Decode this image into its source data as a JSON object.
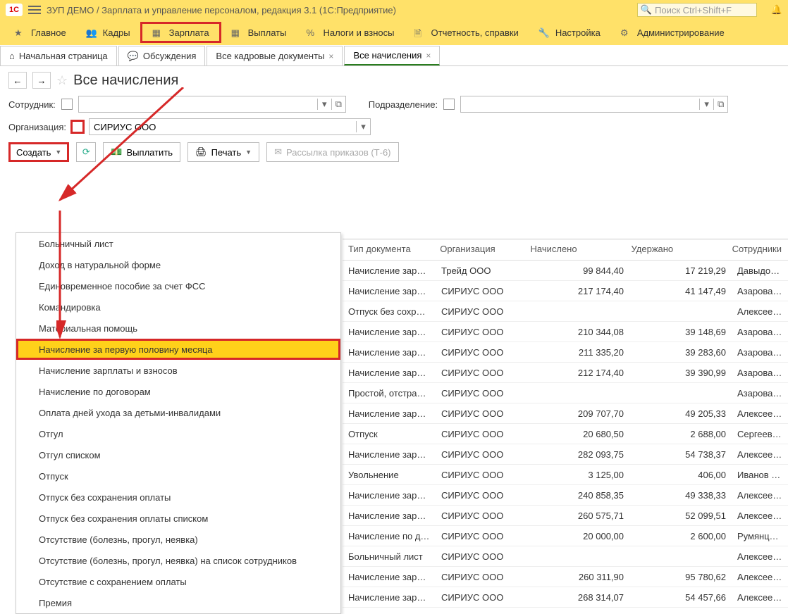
{
  "titlebar": {
    "title": "ЗУП ДЕМО / Зарплата и управление персоналом, редакция 3.1  (1С:Предприятие)",
    "search_placeholder": "Поиск Ctrl+Shift+F"
  },
  "mainmenu": [
    {
      "label": "Главное",
      "icon": "star"
    },
    {
      "label": "Кадры",
      "icon": "people"
    },
    {
      "label": "Зарплата",
      "icon": "grid",
      "highlight": true
    },
    {
      "label": "Выплаты",
      "icon": "grid"
    },
    {
      "label": "Налоги и взносы",
      "icon": "percent"
    },
    {
      "label": "Отчетность, справки",
      "icon": "doc"
    },
    {
      "label": "Настройка",
      "icon": "wrench"
    },
    {
      "label": "Администрирование",
      "icon": "gear"
    }
  ],
  "tabs": [
    {
      "label": "Начальная страница",
      "closable": false,
      "icon": "home"
    },
    {
      "label": "Обсуждения",
      "closable": false,
      "icon": "chat"
    },
    {
      "label": "Все кадровые документы",
      "closable": true
    },
    {
      "label": "Все начисления",
      "closable": true,
      "active": true
    }
  ],
  "page_title": "Все начисления",
  "filters": {
    "employee_label": "Сотрудник:",
    "department_label": "Подразделение:",
    "org_label": "Организация:",
    "org_value": "СИРИУС ООО"
  },
  "toolbar": {
    "create": "Создать",
    "pay": "Выплатить",
    "print": "Печать",
    "mail": "Рассылка приказов (Т-6)"
  },
  "dropdown": [
    "Больничный лист",
    "Доход в натуральной форме",
    "Единовременное пособие за счет ФСС",
    "Командировка",
    "Материальная помощь",
    "Начисление за первую половину месяца",
    "Начисление зарплаты и взносов",
    "Начисление по договорам",
    "Оплата дней ухода за детьми-инвалидами",
    "Отгул",
    "Отгул списком",
    "Отпуск",
    "Отпуск без сохранения оплаты",
    "Отпуск без сохранения оплаты списком",
    "Отсутствие (болезнь, прогул, неявка)",
    "Отсутствие (болезнь, прогул, неявка) на список сотрудников",
    "Отсутствие с сохранением оплаты",
    "Премия"
  ],
  "dropdown_selected": 5,
  "grid": {
    "headers": [
      "Тип документа",
      "Организация",
      "Начислено",
      "Удержано",
      "Сотрудники"
    ],
    "rows": [
      {
        "c": [
          "Начисление зарп…",
          "Трейд ООО",
          "99 844,40",
          "17 219,29",
          "Давыдов Д"
        ]
      },
      {
        "c": [
          "Начисление зарп…",
          "СИРИУС ООО",
          "217 174,40",
          "41 147,49",
          "Азарова А."
        ]
      },
      {
        "c": [
          "Отпуск без сохр…",
          "СИРИУС ООО",
          "",
          "",
          "Алексеева"
        ]
      },
      {
        "c": [
          "Начисление зарп…",
          "СИРИУС ООО",
          "210 344,08",
          "39 148,69",
          "Азарова А."
        ]
      },
      {
        "c": [
          "Начисление зарп…",
          "СИРИУС ООО",
          "211 335,20",
          "39 283,60",
          "Азарова А."
        ]
      },
      {
        "c": [
          "Начисление зарп…",
          "СИРИУС ООО",
          "212 174,40",
          "39 390,99",
          "Азарова А."
        ]
      },
      {
        "c": [
          "Простой, отстран…",
          "СИРИУС ООО",
          "",
          "",
          "Азарова А."
        ]
      },
      {
        "c": [
          "Начисление зарп…",
          "СИРИУС ООО",
          "209 707,70",
          "49 205,33",
          "Алексеева"
        ]
      },
      {
        "c": [
          "Отпуск",
          "СИРИУС ООО",
          "20 680,50",
          "2 688,00",
          "Сергеев Па"
        ]
      },
      {
        "c": [
          "Начисление зарп…",
          "СИРИУС ООО",
          "282 093,75",
          "54 738,37",
          "Алексеева"
        ]
      },
      {
        "c": [
          "Увольнение",
          "СИРИУС ООО",
          "3 125,00",
          "406,00",
          "Иванов Ива"
        ]
      },
      {
        "c": [
          "Начисление зарп…",
          "СИРИУС ООО",
          "240 858,35",
          "49 338,33",
          "Алексеева"
        ]
      },
      {
        "c": [
          "Начисление зарп…",
          "СИРИУС ООО",
          "260 575,71",
          "52 099,51",
          "Алексеева"
        ]
      },
      {
        "c": [
          "Начисление по д…",
          "СИРИУС ООО",
          "20 000,00",
          "2 600,00",
          "Румянцев А"
        ]
      },
      {
        "c": [
          "Больничный лист",
          "СИРИУС ООО",
          "",
          "",
          "Алексеева"
        ]
      },
      {
        "c": [
          "Начисление зарп…",
          "СИРИУС ООО",
          "260 311,90",
          "95 780,62",
          "Алексеева"
        ]
      },
      {
        "c": [
          "Начисление зарп…",
          "СИРИУС ООО",
          "268 314,07",
          "54 457,66",
          "Алексеева"
        ]
      }
    ]
  }
}
